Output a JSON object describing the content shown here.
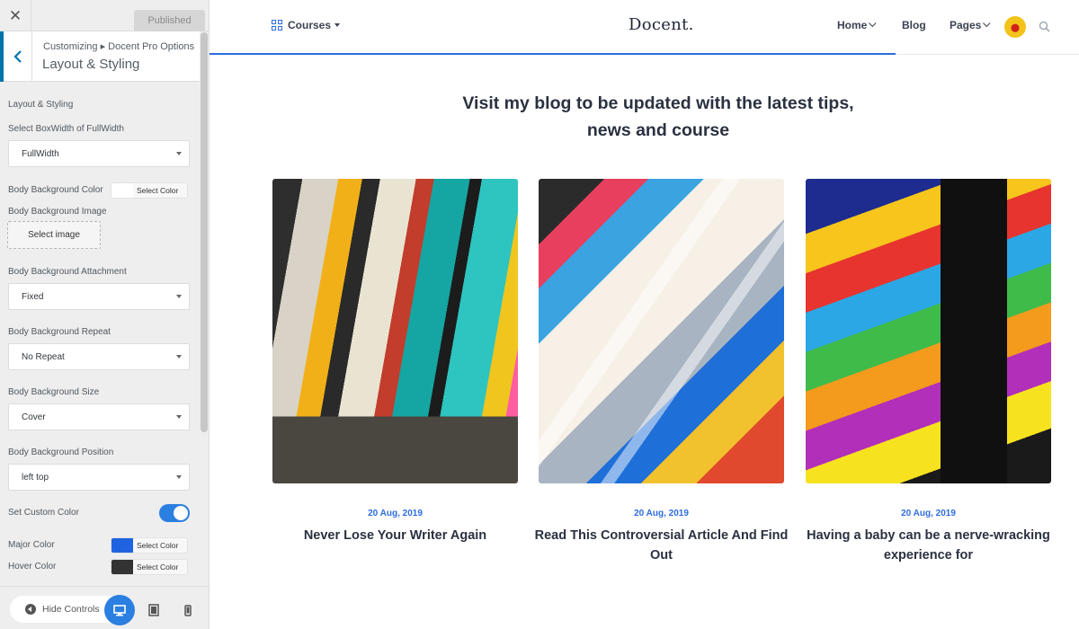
{
  "customizer": {
    "close_icon": "close-icon",
    "publish_label": "Published",
    "breadcrumb": "Customizing ▸ Docent Pro Options",
    "section_title": "Layout & Styling",
    "group_title": "Layout & Styling",
    "fields": {
      "box_width": {
        "label": "Select BoxWidth of FullWidth",
        "value": "FullWidth"
      },
      "bg_color": {
        "label": "Body Background Color",
        "button": "Select Color",
        "swatch": "#ffffff"
      },
      "bg_image": {
        "label": "Body Background Image",
        "button": "Select image"
      },
      "bg_attachment": {
        "label": "Body Background Attachment",
        "value": "Fixed"
      },
      "bg_repeat": {
        "label": "Body Background Repeat",
        "value": "No Repeat"
      },
      "bg_size": {
        "label": "Body Background Size",
        "value": "Cover"
      },
      "bg_position": {
        "label": "Body Background Position",
        "value": "left top"
      },
      "custom_color": {
        "label": "Set Custom Color",
        "enabled": true
      },
      "major_color": {
        "label": "Major Color",
        "button": "Select Color",
        "swatch": "#1f63e0"
      },
      "hover_color": {
        "label": "Hover Color",
        "button": "Select Color",
        "swatch": "#333333"
      }
    },
    "footer": {
      "hide_controls_label": "Hide Controls",
      "active_device": "desktop"
    }
  },
  "site": {
    "nav": {
      "courses_label": "Courses",
      "logo": "Docent.",
      "home_label": "Home",
      "blog_label": "Blog",
      "pages_label": "Pages"
    },
    "heading_line1": "Visit my blog to be updated with the latest tips,",
    "heading_line2": "news and course",
    "accent_color": "#2d6cdf",
    "posts": [
      {
        "date": "20 Aug, 2019",
        "title": "Never Lose Your Writer Again"
      },
      {
        "date": "20 Aug, 2019",
        "title": "Read This Controversial Article And Find Out"
      },
      {
        "date": "20 Aug, 2019",
        "title": "Having a baby can be a nerve-wracking experience for"
      }
    ]
  }
}
